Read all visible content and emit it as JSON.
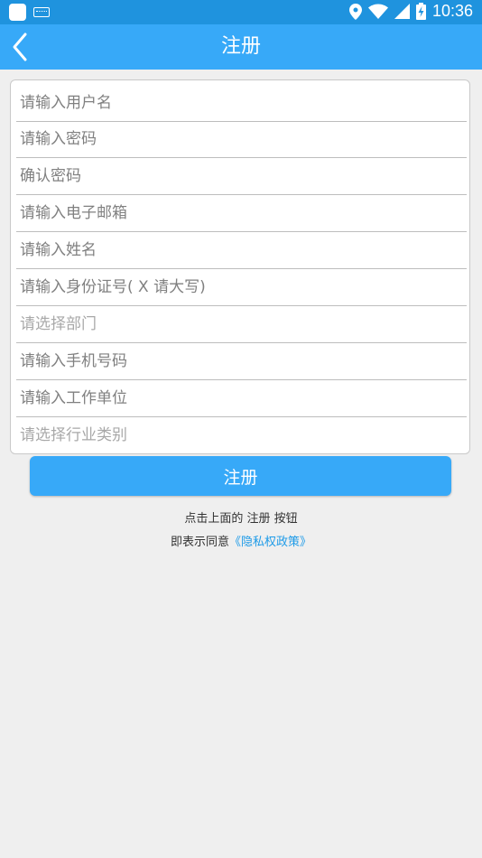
{
  "status_bar": {
    "time": "10:36"
  },
  "app_bar": {
    "title": "注册"
  },
  "form": {
    "username_placeholder": "请输入用户名",
    "password_placeholder": "请输入密码",
    "confirm_password_placeholder": "确认密码",
    "email_placeholder": "请输入电子邮箱",
    "name_placeholder": "请输入姓名",
    "id_number_placeholder": "请输入身份证号( X 请大写)",
    "department_select": "请选择部门",
    "phone_placeholder": "请输入手机号码",
    "work_unit_placeholder": "请输入工作单位",
    "industry_select": "请选择行业类别"
  },
  "submit_label": "注册",
  "notice": {
    "line1": "点击上面的 注册 按钮",
    "line2_prefix": "即表示同意",
    "policy_link": "《隐私权政策》"
  },
  "colors": {
    "status_bar": "#1f93de",
    "primary": "#37a9f8",
    "link": "#1e9be8"
  }
}
